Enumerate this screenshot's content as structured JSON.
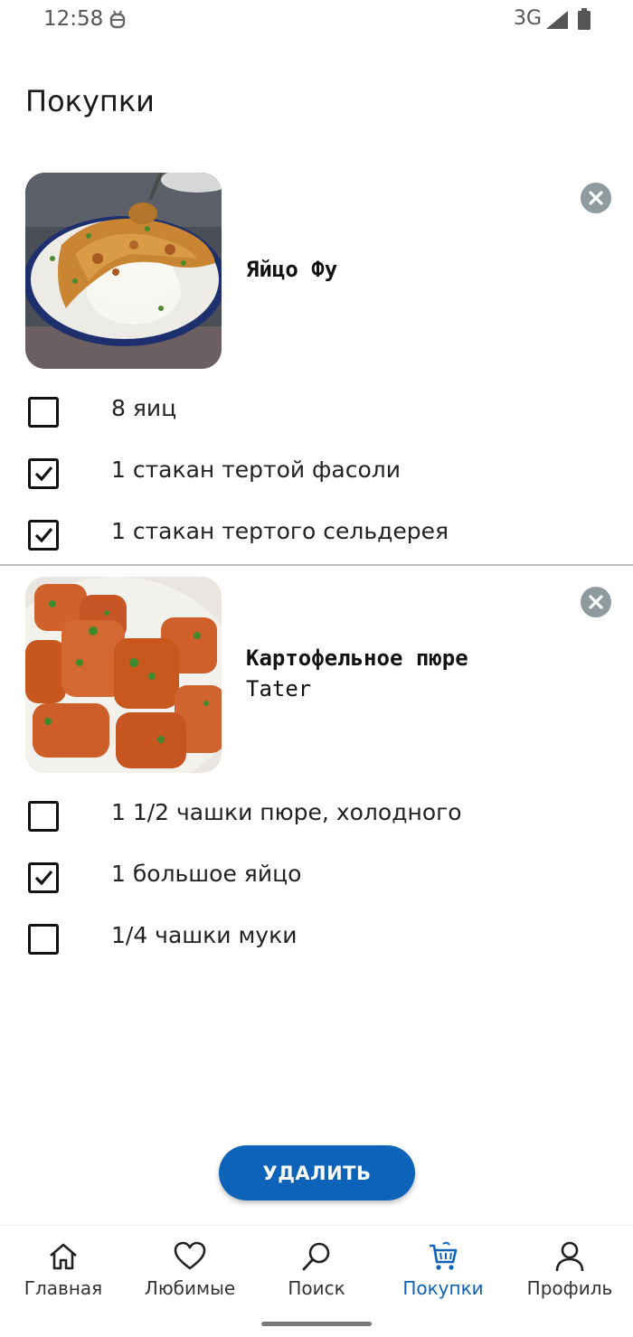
{
  "status_bar": {
    "time": "12:58",
    "network": "3G"
  },
  "page": {
    "title": "Покупки"
  },
  "recipes": [
    {
      "name_line1": "Яйцо Фу",
      "name_line2": "",
      "ingredients": [
        {
          "label": "8 яиц",
          "checked": false
        },
        {
          "label": "1 стакан тертой фасоли",
          "checked": true
        },
        {
          "label": "1 стакан тертого сельдерея",
          "checked": true
        }
      ]
    },
    {
      "name_line1": "Картофельное пюре",
      "name_line2": "Tater",
      "ingredients": [
        {
          "label": "1 1/2 чашки пюре, холодного",
          "checked": false
        },
        {
          "label": "1 большое яйцо",
          "checked": true
        },
        {
          "label": "1/4 чашки муки",
          "checked": false
        }
      ]
    }
  ],
  "actions": {
    "delete_label": "УДАЛИТЬ"
  },
  "bottom_nav": [
    {
      "label": "Главная",
      "icon": "home-icon",
      "active": false
    },
    {
      "label": "Любимые",
      "icon": "heart-icon",
      "active": false
    },
    {
      "label": "Поиск",
      "icon": "search-icon",
      "active": false
    },
    {
      "label": "Покупки",
      "icon": "cart-icon",
      "active": true
    },
    {
      "label": "Профиль",
      "icon": "profile-icon",
      "active": false
    }
  ],
  "colors": {
    "accent": "#0d62b9",
    "remove_button": "#8e9a9e",
    "divider": "#bdbdbd"
  }
}
